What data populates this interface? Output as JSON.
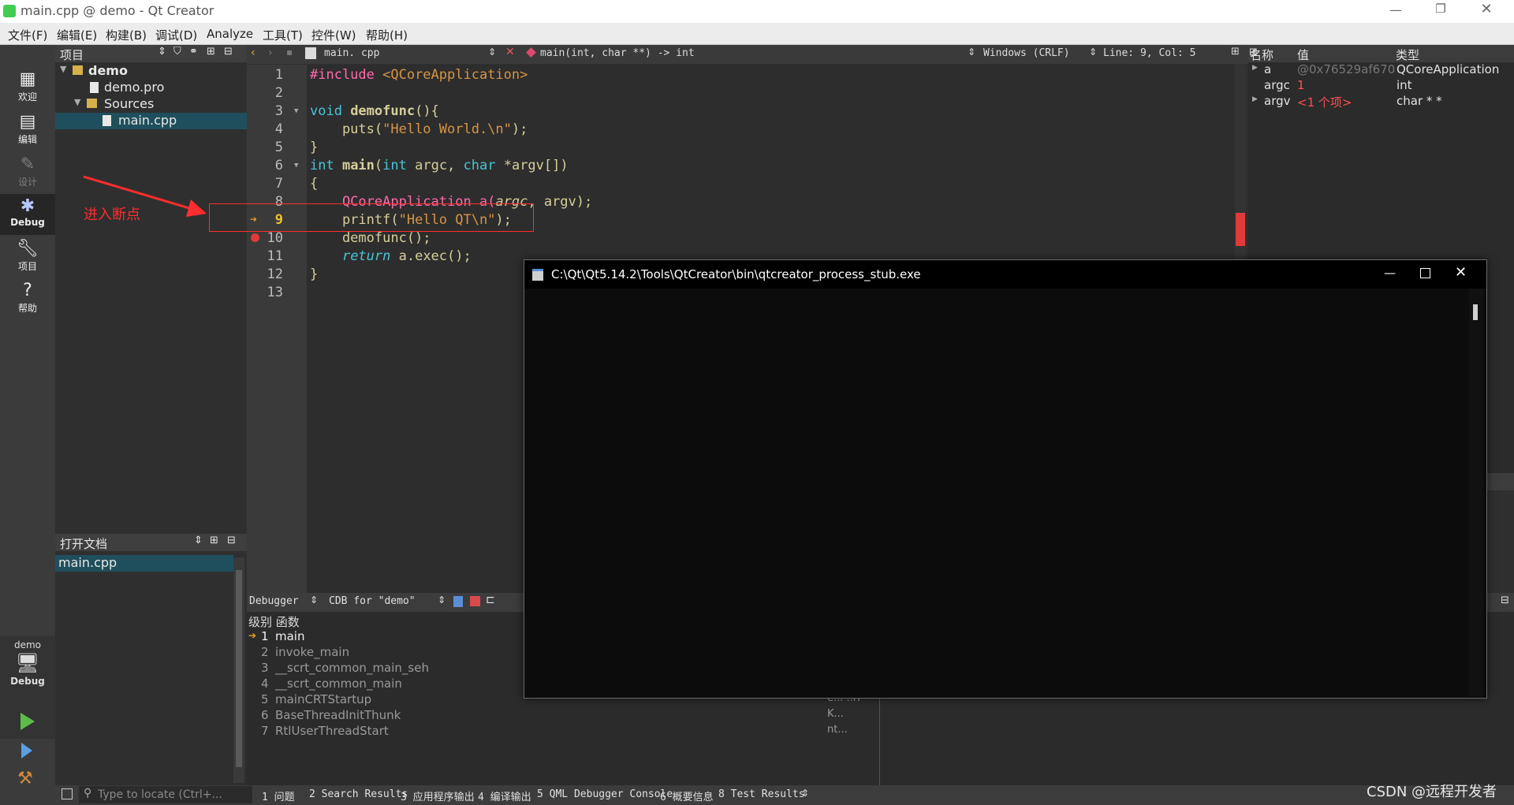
{
  "window": {
    "title": "main.cpp @ demo - Qt Creator",
    "controls": [
      "minimize",
      "restore",
      "close"
    ]
  },
  "menu": [
    "文件(F)",
    "编辑(E)",
    "构建(B)",
    "调试(D)",
    "Analyze",
    "工具(T)",
    "控件(W)",
    "帮助(H)"
  ],
  "modes": [
    {
      "label": "欢迎",
      "icon": "grid-icon"
    },
    {
      "label": "编辑",
      "icon": "document-icon"
    },
    {
      "label": "设计",
      "icon": "pencil-icon"
    },
    {
      "label": "Debug",
      "icon": "bug-icon"
    },
    {
      "label": "项目",
      "icon": "wrench-icon"
    },
    {
      "label": "帮助",
      "icon": "help-icon"
    }
  ],
  "kit": {
    "project": "demo",
    "mode": "Debug"
  },
  "project_panel": {
    "header": "项目",
    "tree": [
      "demo",
      "demo.pro",
      "Sources",
      "main.cpp"
    ]
  },
  "open_docs": {
    "header": "打开文档",
    "items": [
      "main.cpp"
    ]
  },
  "annotation": {
    "text": "进入断点",
    "color": "#ff2d2d"
  },
  "editor": {
    "file": "main. cpp",
    "function": "main(int, char **) -> int",
    "line_ending": "Windows (CRLF)",
    "position": "Line: 9, Col: 5",
    "line_numbers": [
      "1",
      "2",
      "3",
      "4",
      "5",
      "6",
      "7",
      "8",
      "9",
      "10",
      "11",
      "12",
      "13"
    ],
    "current_line": "9"
  },
  "code": {
    "l1_a": "#include ",
    "l1_b": "<QCoreApplication>",
    "l3_a": "void ",
    "l3_b": "demofunc",
    "l3_c": "(){",
    "l4_a": "    puts(",
    "l4_b": "\"Hello World.\\n\"",
    "l4_c": ");",
    "l5": "}",
    "l6_a": "int ",
    "l6_b": "main",
    "l6_c": "(",
    "l6_d": "int",
    "l6_e": " argc, ",
    "l6_f": "char",
    "l6_g": " *argv[])",
    "l7": "{",
    "l8_a": "    QCoreApplication a(",
    "l8_b": "argc",
    "l8_c": ", argv);",
    "l9_a": "    printf(",
    "l9_b": "\"Hello QT\\n\"",
    "l9_c": ");",
    "l10": "    demofunc();",
    "l11_a": "    ",
    "l11_b": "return",
    "l11_c": " a.exec();",
    "l12": "}"
  },
  "locals": {
    "headers": [
      "名称",
      "值",
      "类型"
    ],
    "rows": [
      {
        "name": "a",
        "value": "@0x76529af670",
        "type": "QCoreApplication"
      },
      {
        "name": "argc",
        "value": "1",
        "type": "int"
      },
      {
        "name": "argv",
        "value": "<1 个项>",
        "type": "char * *"
      }
    ]
  },
  "debugger_bar": {
    "mode": "Debugger",
    "engine": "CDB for \"demo\""
  },
  "stack": {
    "header": "级别 函数",
    "frames": [
      {
        "level": "1",
        "func": "main"
      },
      {
        "level": "2",
        "func": "invoke_main"
      },
      {
        "level": "3",
        "func": "__scrt_common_main_seh"
      },
      {
        "level": "4",
        "func": "__scrt_common_main"
      },
      {
        "level": "5",
        "func": "mainCRTStartup"
      },
      {
        "level": "6",
        "func": "BaseThreadInitThunk"
      },
      {
        "level": "7",
        "func": "RtlUserThreadStart"
      }
    ],
    "clipped": [
      "e...  ..l7",
      "K...",
      "nt..."
    ]
  },
  "output_tabs": {
    "locate_placeholder": "Type to locate (Ctrl+...",
    "tabs": [
      "1 问题",
      "2 Search Results",
      "3 应用程序输出",
      "4 编译输出",
      "5 QML Debugger Console",
      "6 概要信息",
      "8 Test Results"
    ]
  },
  "console": {
    "title": "C:\\Qt\\Qt5.14.2\\Tools\\QtCreator\\bin\\qtcreator_process_stub.exe"
  },
  "watermark": "CSDN @远程开发者"
}
